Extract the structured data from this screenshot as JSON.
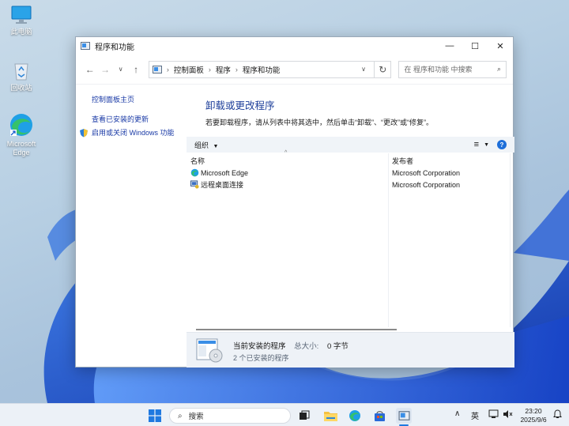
{
  "desktop": {
    "icons": [
      {
        "label": "此电脑"
      },
      {
        "label": "回收站"
      },
      {
        "label": "Microsoft Edge"
      }
    ]
  },
  "window": {
    "title": "程序和功能",
    "controls": {
      "minimize": "—",
      "maximize": "☐",
      "close": "✕"
    },
    "breadcrumb": [
      "控制面板",
      "程序",
      "程序和功能"
    ],
    "search_placeholder": "在 程序和功能 中搜索",
    "sidebar": {
      "links": [
        "控制面板主页",
        "查看已安装的更新",
        "启用或关闭 Windows 功能"
      ]
    },
    "main": {
      "heading": "卸载或更改程序",
      "description": "若要卸载程序，请从列表中将其选中，然后单击“卸载”、“更改”或“修复”。",
      "organize_label": "组织",
      "columns": {
        "name": "名称",
        "publisher": "发布者"
      },
      "rows": [
        {
          "name": "Microsoft Edge",
          "publisher": "Microsoft Corporation",
          "icon": "edge-icon"
        },
        {
          "name": "远程桌面连接",
          "publisher": "Microsoft Corporation",
          "icon": "remote-desktop-icon"
        }
      ],
      "details": {
        "title": "当前安装的程序",
        "size_label": "总大小:",
        "size_value": "0 字节",
        "count_text": "2 个已安装的程序"
      }
    }
  },
  "taskbar": {
    "search_label": "搜索",
    "ime": "英",
    "time": "23:20",
    "date": "2025/9/6"
  },
  "colors": {
    "link": "#1a3aa6",
    "heading": "#1e3f9a",
    "accent": "#1e6fd9"
  }
}
